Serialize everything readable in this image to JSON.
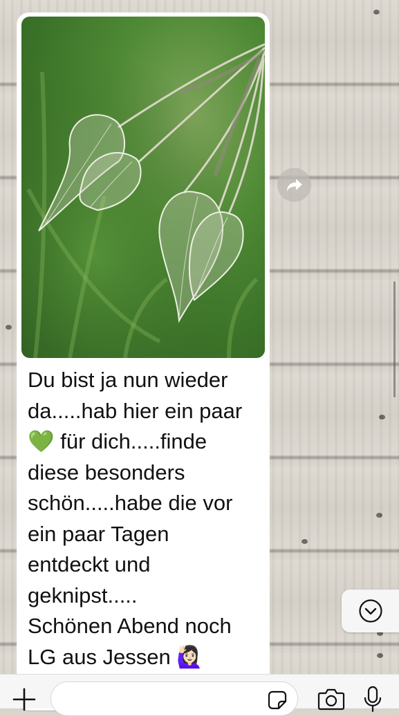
{
  "message": {
    "text": "Du bist ja nun wieder\nda.....hab hier ein paar\n💚 für dich.....finde\ndiese besonders\nschön.....habe die vor\nein paar Tagen\nentdeckt und\ngeknipst.....\nSchönen Abend noch\nLG aus Jessen 🙋🏻‍♀️"
  },
  "icons": {
    "forward": "forward-arrow-icon",
    "scroll_down": "chevron-down-circle-icon",
    "plus": "plus-icon",
    "sticker": "sticker-icon",
    "camera": "camera-icon",
    "mic": "microphone-icon"
  },
  "input": {
    "placeholder": ""
  },
  "colors": {
    "bubble": "#ffffff",
    "text": "#111111",
    "wallpaper": "#d9d4cc",
    "input_bar": "#f6f6f6"
  }
}
